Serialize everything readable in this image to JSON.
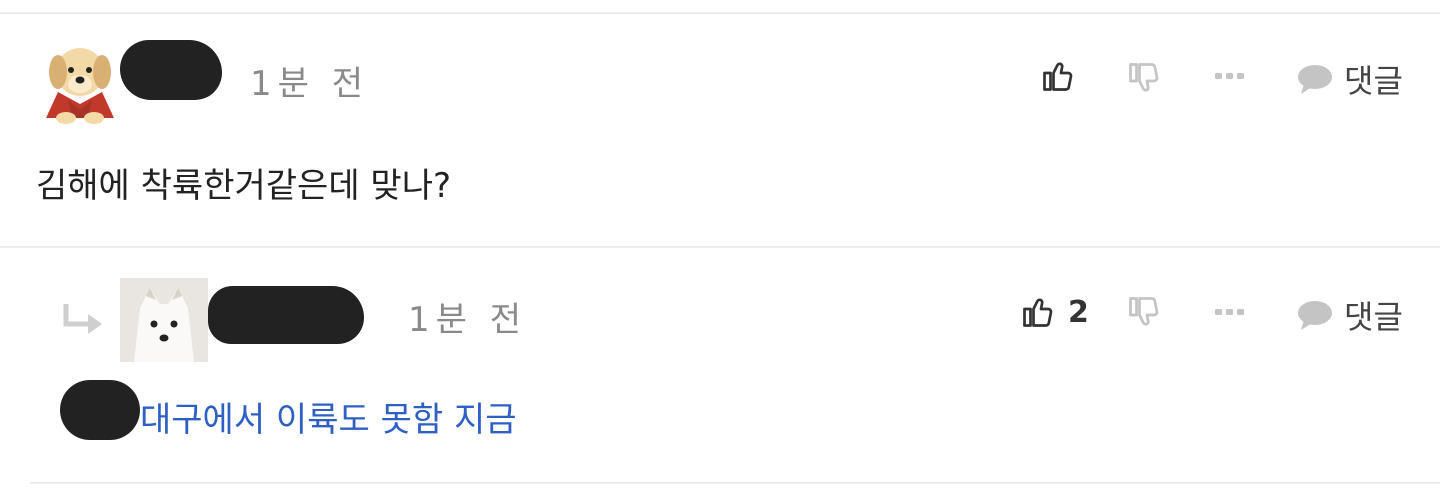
{
  "comments": [
    {
      "time": "1분 전",
      "text": "김해에 착륙한거같은데 맞나?",
      "like_count": "",
      "reply_label": "댓글"
    },
    {
      "time": "1분 전",
      "text": "대구에서 이륙도 못함 지금",
      "like_count": "2",
      "reply_label": "댓글"
    }
  ],
  "icons": {
    "avatar_1": "puppy-avatar",
    "avatar_2": "arctic-fox-avatar",
    "like": "thumbs-up-icon",
    "dislike": "thumbs-down-icon",
    "more": "more-dots-icon",
    "reply": "speech-bubble-icon",
    "reply_indicator": "reply-arrow-icon"
  },
  "colors": {
    "text": "#222222",
    "mention_text": "#2d5fc4",
    "meta": "#8a8a8a",
    "icon_muted": "#c4c4c4",
    "divider": "#ececec"
  }
}
